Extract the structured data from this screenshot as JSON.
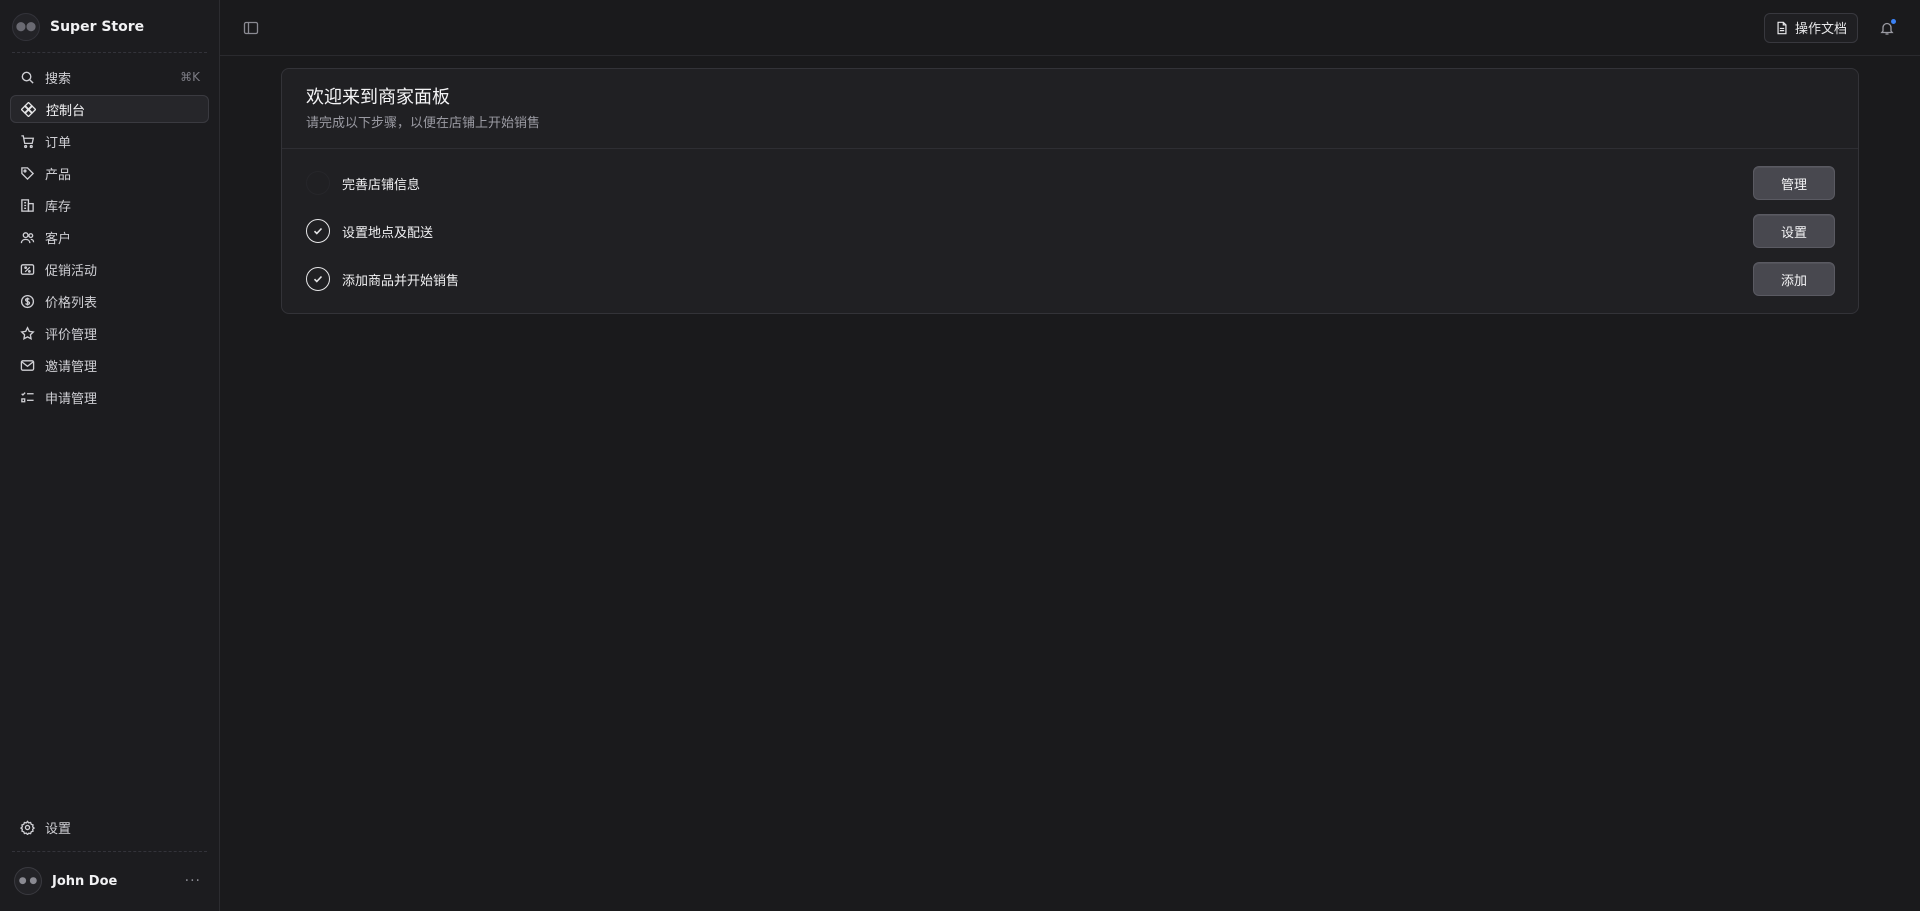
{
  "store": {
    "name": "Super Store"
  },
  "search": {
    "label": "搜索",
    "shortcut": "⌘K"
  },
  "nav": {
    "items": [
      {
        "label": "控制台",
        "icon": "dashboard-icon",
        "active": true
      },
      {
        "label": "订单",
        "icon": "cart-icon"
      },
      {
        "label": "产品",
        "icon": "tag-icon"
      },
      {
        "label": "库存",
        "icon": "buildings-icon"
      },
      {
        "label": "客户",
        "icon": "users-icon"
      },
      {
        "label": "促销活动",
        "icon": "receipt-percent-icon"
      },
      {
        "label": "价格列表",
        "icon": "currency-dollar-icon"
      },
      {
        "label": "评价管理",
        "icon": "star-icon"
      },
      {
        "label": "邀请管理",
        "icon": "envelope-icon"
      },
      {
        "label": "申请管理",
        "icon": "checklist-icon"
      }
    ]
  },
  "settings": {
    "label": "设置"
  },
  "user": {
    "name": "John Doe",
    "more": "···"
  },
  "topbar": {
    "docs_label": "操作文档"
  },
  "card": {
    "title": "欢迎来到商家面板",
    "subtitle": "请完成以下步骤，以便在店铺上开始销售",
    "steps": [
      {
        "label": "完善店铺信息",
        "done": false,
        "button": "管理"
      },
      {
        "label": "设置地点及配送",
        "done": true,
        "button": "设置"
      },
      {
        "label": "添加商品并开始销售",
        "done": true,
        "button": "添加"
      }
    ]
  },
  "colors": {
    "background": "#1a1a1c",
    "sidebar": "#1c1c1f",
    "accent_dot": "#3b82f6"
  }
}
